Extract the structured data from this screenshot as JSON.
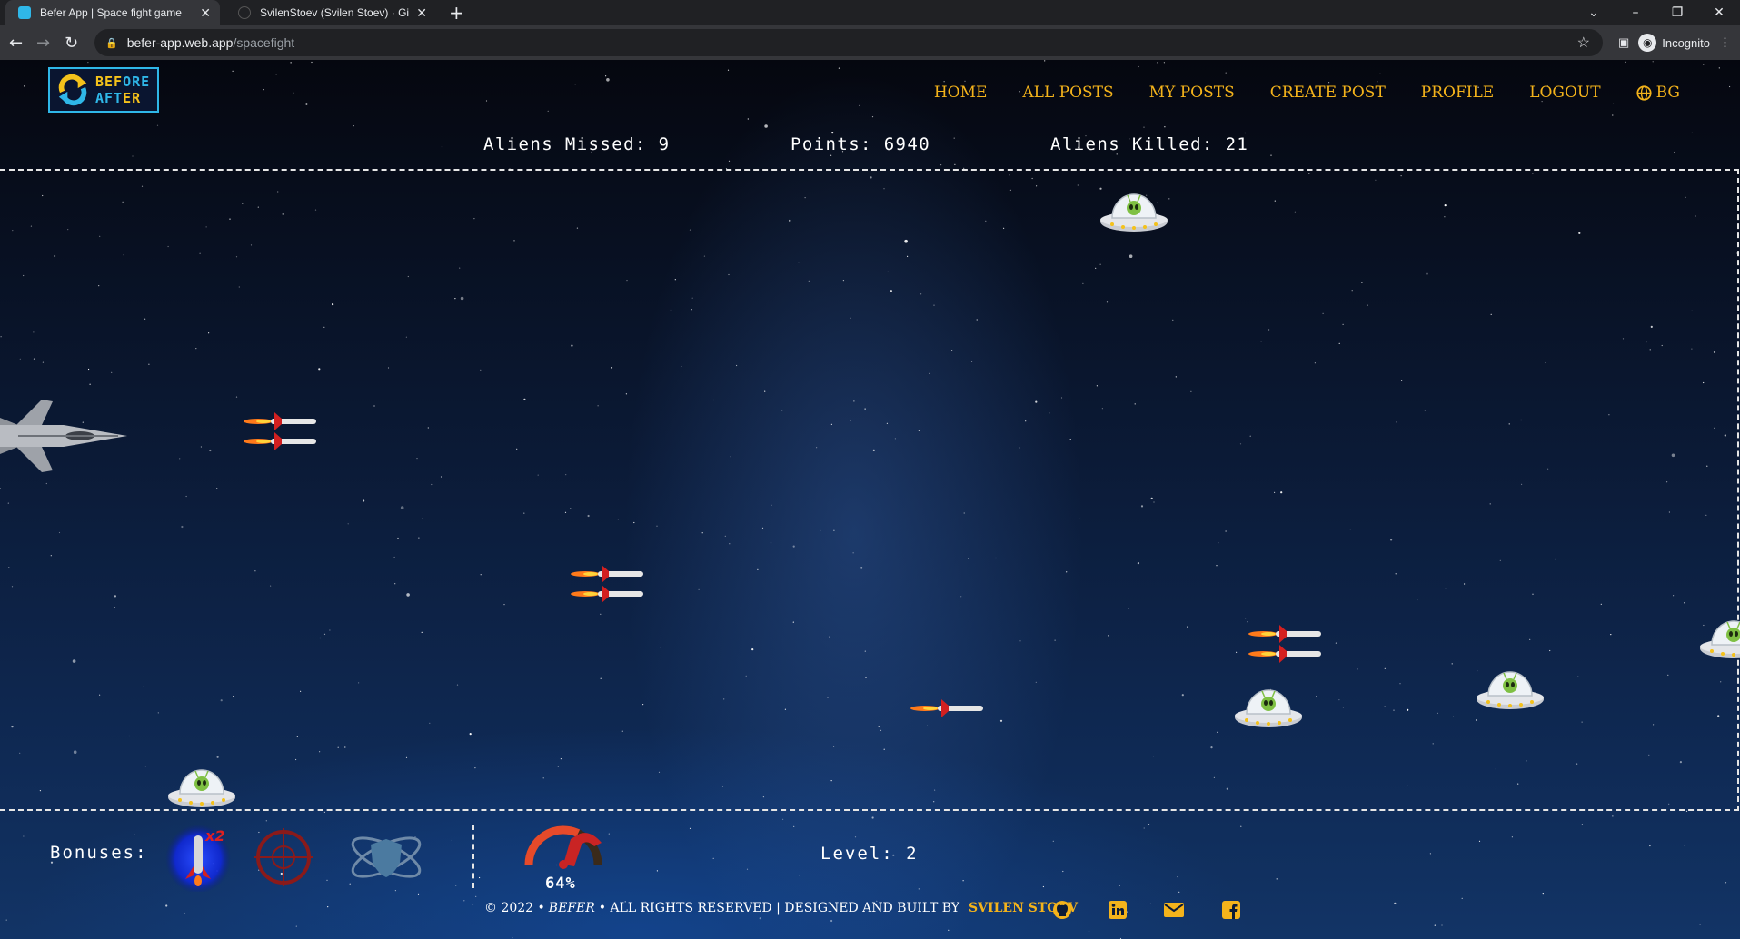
{
  "browser": {
    "tabs": [
      {
        "title": "Befer App | Space fight game",
        "active": true
      },
      {
        "title": "SvilenStoev (Svilen Stoev) · GitHu",
        "active": false
      }
    ],
    "url_host": "befer-app.web.app",
    "url_path": "/spacefight",
    "incognito_label": "Incognito"
  },
  "header": {
    "logo_line1_a": "BEF",
    "logo_line1_b": "ORE",
    "logo_line2_a": "AFT",
    "logo_line2_b": "ER",
    "nav": [
      {
        "label": "HOME"
      },
      {
        "label": "ALL POSTS"
      },
      {
        "label": "MY POSTS"
      },
      {
        "label": "CREATE POST"
      },
      {
        "label": "PROFILE"
      },
      {
        "label": "LOGOUT"
      }
    ],
    "language": "BG"
  },
  "game": {
    "aliens_missed": "Aliens Missed: 9",
    "points": "Points: 6940",
    "aliens_killed": "Aliens Killed: 21",
    "bonuses_label": "Bonuses:",
    "bonuses": [
      {
        "name": "double-missile",
        "badge": "x2",
        "active": true
      },
      {
        "name": "crosshair",
        "active": false
      },
      {
        "name": "shield",
        "active": false
      }
    ],
    "speed_value": "64%",
    "speed_fraction": 0.64,
    "level": "Level: 2"
  },
  "footer": {
    "copyright": "© 2022 •",
    "brand": "BEFER",
    "rights": "• ALL RIGHTS RESERVED | DESIGNED AND BUILT BY",
    "author": "SVILEN STOEV",
    "social": [
      "github-icon",
      "linkedin-icon",
      "email-icon",
      "facebook-icon"
    ]
  },
  "colors": {
    "accent": "#f4b31b",
    "logo_blue": "#2fb7e8",
    "background": "#0b1a36"
  }
}
